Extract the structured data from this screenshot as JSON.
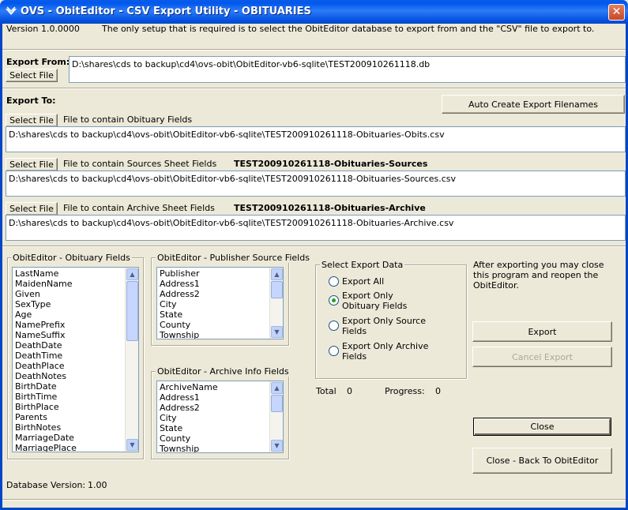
{
  "window": {
    "title": "OVS - ObitEditor - CSV Export Utility - OBITUARIES",
    "close_glyph": "✕"
  },
  "header": {
    "version": "Version 1.0.0000",
    "instructions": "The only setup that is required is to select the ObitEditor database to export from and the \"CSV\" file to export to."
  },
  "export_from": {
    "label": "Export From:",
    "select_label": "Select File",
    "path": "D:\\shares\\cds to backup\\cd4\\ovs-obit\\ObitEditor-vb6-sqlite\\TEST200910261118.db"
  },
  "export_to": {
    "label": "Export To:",
    "auto_create_label": "Auto Create Export Filenames",
    "obits": {
      "select_label": "Select File",
      "desc": "File to contain Obituary Fields",
      "name": "",
      "path": "D:\\shares\\cds to backup\\cd4\\ovs-obit\\ObitEditor-vb6-sqlite\\TEST200910261118-Obituaries-Obits.csv"
    },
    "sources": {
      "select_label": "Select File",
      "desc": "File to contain Sources Sheet Fields",
      "name": "TEST200910261118-Obituaries-Sources",
      "path": "D:\\shares\\cds to backup\\cd4\\ovs-obit\\ObitEditor-vb6-sqlite\\TEST200910261118-Obituaries-Sources.csv"
    },
    "archive": {
      "select_label": "Select File",
      "desc": "File to contain Archive Sheet Fields",
      "name": "TEST200910261118-Obituaries-Archive",
      "path": "D:\\shares\\cds to backup\\cd4\\ovs-obit\\ObitEditor-vb6-sqlite\\TEST200910261118-Obituaries-Archive.csv"
    }
  },
  "obituary_fields": {
    "legend": "ObitEditor - Obituary Fields",
    "items": [
      "LastName",
      "MaidenName",
      "Given",
      "SexType",
      "Age",
      "NamePrefix",
      "NameSuffix",
      "DeathDate",
      "DeathTime",
      "DeathPlace",
      "DeathNotes",
      "BirthDate",
      "BirthTime",
      "BirthPlace",
      "Parents",
      "BirthNotes",
      "MarriageDate",
      "MarriagePlace"
    ]
  },
  "publisher_fields": {
    "legend": "ObitEditor - Publisher Source Fields",
    "items": [
      "Publisher",
      "Address1",
      "Address2",
      "City",
      "State",
      "County",
      "Township"
    ]
  },
  "archive_fields": {
    "legend": "ObitEditor - Archive Info Fields",
    "items": [
      "ArchiveName",
      "Address1",
      "Address2",
      "City",
      "State",
      "County",
      "Township"
    ]
  },
  "export_data": {
    "legend": "Select Export Data",
    "options": [
      {
        "line1": "Export All",
        "line2": ""
      },
      {
        "line1": "Export Only",
        "line2": "Obituary Fields"
      },
      {
        "line1": "Export  Only Source",
        "line2": "Fields"
      },
      {
        "line1": "Export  Only Archive",
        "line2": "Fields"
      }
    ],
    "selected": 1
  },
  "status": {
    "total_label": "Total",
    "total_value": "0",
    "progress_label": "Progress:",
    "progress_value": "0"
  },
  "notice": "After exporting you may close this program and reopen the ObitEditor.",
  "actions": {
    "export_label": "Export",
    "cancel_label": "Cancel Export",
    "close_label": "Close",
    "back_label": "Close - Back To ObitEditor"
  },
  "footer": {
    "db_version_label": "Database Version:",
    "db_version_value": "1.00"
  }
}
